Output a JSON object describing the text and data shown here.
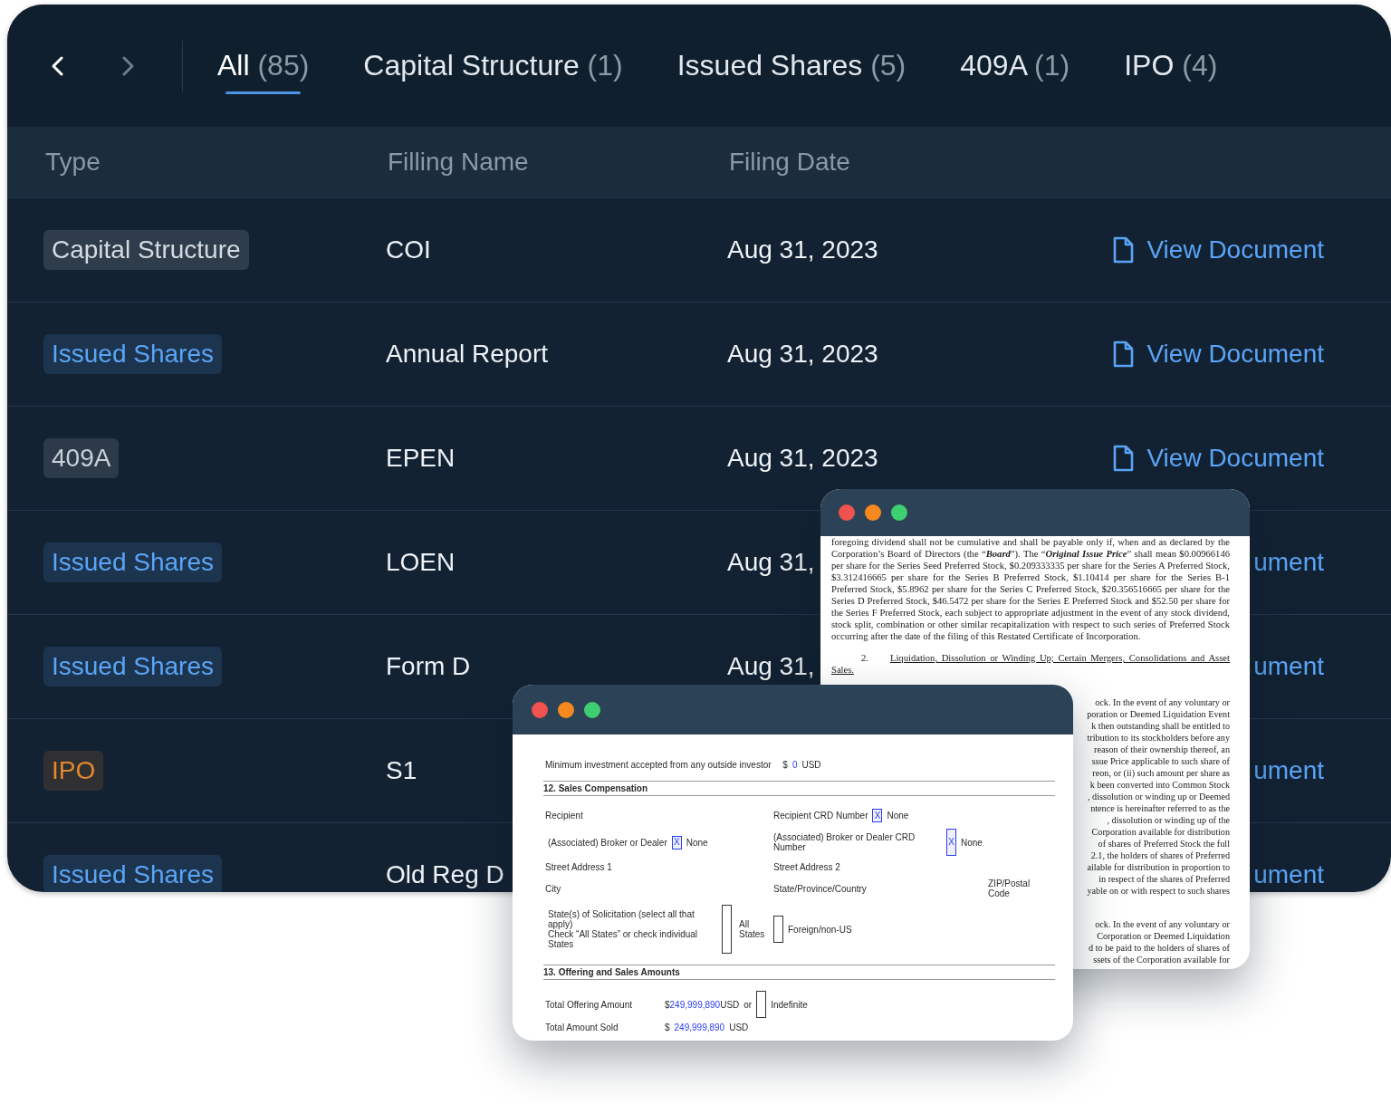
{
  "nav": {
    "back": {
      "disabled": false
    },
    "forward": {
      "disabled": true
    }
  },
  "tabs": [
    {
      "label": "All",
      "count": "(85)",
      "selected": true
    },
    {
      "label": "Capital Structure",
      "count": "(1)",
      "selected": false
    },
    {
      "label": "Issued Shares",
      "count": "(5)",
      "selected": false
    },
    {
      "label": "409A",
      "count": "(1)",
      "selected": false
    },
    {
      "label": "IPO",
      "count": "(4)",
      "selected": false
    }
  ],
  "table": {
    "columns": [
      "Type",
      "Filling Name",
      "Filing Date"
    ],
    "rows": [
      {
        "type": {
          "label": "Capital Structure",
          "color": "#d5dbe2"
        },
        "name": "COI",
        "date": "Aug 31, 2023",
        "link": {
          "text": "View Document",
          "icon": true
        }
      },
      {
        "type": {
          "label": "Issued Shares",
          "color": "#5aa5f7"
        },
        "name": "Annual Report",
        "date": "Aug 31, 2023",
        "link": {
          "text": "View Document",
          "icon": true
        }
      },
      {
        "type": {
          "label": "409A",
          "color": "#c9d0d8"
        },
        "name": "EPEN",
        "date": "Aug 31, 2023",
        "link": {
          "text": "View Document",
          "icon": true
        }
      },
      {
        "type": {
          "label": "Issued Shares",
          "color": "#5aa5f7"
        },
        "name": "LOEN",
        "date": "Aug 31,",
        "link": {
          "text": "ument",
          "icon": false
        }
      },
      {
        "type": {
          "label": "Issued Shares",
          "color": "#5aa5f7"
        },
        "name": "Form D",
        "date": "Aug 31,",
        "link": {
          "text": "ument",
          "icon": false
        }
      },
      {
        "type": {
          "label": "IPO",
          "color": "#e2892c"
        },
        "name": "S1",
        "link": {
          "text": "ument",
          "icon": false
        }
      },
      {
        "type": {
          "label": "Issued Shares",
          "color": "#5aa5f7"
        },
        "name": "Old Reg D",
        "link": {
          "text": "ument",
          "icon": false
        }
      }
    ]
  },
  "back_document": {
    "paragraph": "foregoing dividend shall not be cumulative and shall be payable only if, when and as declared by the Corporation’s Board of Directors (the “**Board**”).  The “**Original Issue Price**” shall mean $0.00966146 per share for the Series Seed Preferred Stock, $0.209333335 per share for the Series A Preferred Stock, $3.312416665 per share for the Series B Preferred Stock, $1.10414 per share for the Series B-1 Preferred Stock, $5.8962 per share for the Series C Preferred Stock, $20.356516665 per share for the Series D Preferred Stock, $46.5472 per share for the Series E Preferred Stock and $52.50 per share for the Series F Preferred Stock, each subject to appropriate adjustment in the event of any stock dividend, stock split, combination or other similar recapitalization with respect to such series of Preferred Stock occurring after the date of the filing of this Restated Certificate of Incorporation.",
    "heading": {
      "number": "2.",
      "title": "Liquidation, Dissolution or Winding Up; Certain Mergers, Consolidations and Asset Sales."
    },
    "fragments": [
      {
        "lines": [
          "ock.  In the event of any voluntary or",
          "poration or Deemed Liquidation Event",
          "k then outstanding shall be entitled to",
          "tribution to its stockholders before any",
          "reason of their ownership thereof, an",
          "ssue Price applicable to such share of",
          "reon, or (ii) such amount per share as",
          "k been converted into Common Stock",
          ", dissolution or winding up or Deemed",
          "ntence is hereinafter referred to as the",
          ", dissolution or winding up of the",
          "Corporation available for distribution",
          "of shares of Preferred Stock the full",
          "2.1, the holders of shares of Preferred",
          "ailable for distribution in proportion to",
          "in respect of the shares of Preferred",
          "yable on or with respect to such shares"
        ]
      },
      {
        "lines": [
          "ock.  In the event of any voluntary or",
          "Corporation or Deemed Liquidation",
          "d to be paid to the holders of shares of",
          "ssets of the Corporation available for"
        ]
      }
    ]
  },
  "form": {
    "min_investment": {
      "label": "Minimum investment accepted from any outside investor",
      "symbol": "$",
      "amount": "0",
      "unit": "USD"
    },
    "section_12": "12. Sales Compensation",
    "recipient": "Recipient",
    "recipient_crd": {
      "label": "Recipient CRD Number",
      "checked": true,
      "mark": "X",
      "option": "None"
    },
    "broker": {
      "label": "(Associated) Broker or Dealer",
      "checked": true,
      "mark": "X",
      "option": "None"
    },
    "broker_crd": {
      "label": "(Associated) Broker or Dealer CRD Number",
      "checked": true,
      "mark": "X",
      "option": "None"
    },
    "street_1": "Street Address 1",
    "street_2": "Street Address 2",
    "city": "City",
    "state_province": "State/Province/Country",
    "zip": "ZIP/Postal Code",
    "solicitation": {
      "label_1": "State(s) of Solicitation (select all that apply)",
      "label_2": "Check “All States” or check individual States",
      "all_states": {
        "checked": false,
        "option": "All States"
      },
      "foreign": {
        "checked": false,
        "option": "Foreign/non-US"
      }
    },
    "section_13": "13. Offering and Sales Amounts",
    "total_offering": {
      "label": "Total Offering Amount",
      "symbol": "$",
      "amount": "249,999,890",
      "unit": "USD",
      "or": "or",
      "indefinite": {
        "checked": false,
        "option": "Indefinite"
      }
    },
    "total_sold": {
      "label": "Total Amount Sold",
      "symbol": "$",
      "amount": "249,999,890",
      "unit": "USD"
    }
  }
}
